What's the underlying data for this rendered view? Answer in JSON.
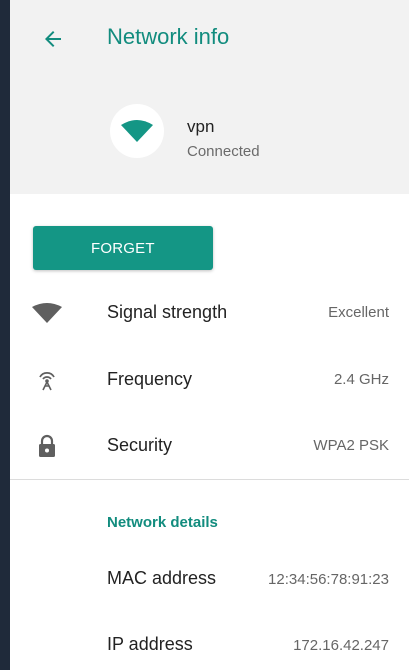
{
  "header": {
    "title": "Network info",
    "back_icon": "arrow-back-icon",
    "accent_color": "#128c7e"
  },
  "network": {
    "name": "vpn",
    "status": "Connected",
    "icon": "wifi-icon"
  },
  "actions": {
    "forget_label": "FORGET",
    "button_color": "#149685"
  },
  "info_rows": [
    {
      "icon": "signal-strength-icon",
      "label": "Signal strength",
      "value": "Excellent"
    },
    {
      "icon": "frequency-antenna-icon",
      "label": "Frequency",
      "value": "2.4 GHz"
    },
    {
      "icon": "lock-icon",
      "label": "Security",
      "value": "WPA2 PSK"
    }
  ],
  "details": {
    "section_title": "Network details",
    "rows": [
      {
        "label": "MAC address",
        "value": "12:34:56:78:91:23"
      },
      {
        "label": "IP address",
        "value": "172.16.42.247"
      }
    ]
  }
}
